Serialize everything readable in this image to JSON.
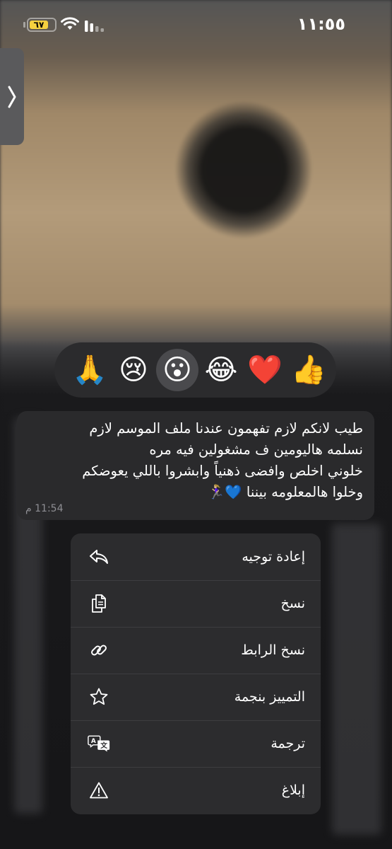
{
  "status_bar": {
    "time": "١١:٥٥",
    "battery_level": "٦٧"
  },
  "reactions": [
    {
      "emoji": "👍",
      "name": "thumbs-up"
    },
    {
      "emoji": "❤️",
      "name": "heart"
    },
    {
      "emoji": "😂",
      "name": "laughing"
    },
    {
      "emoji": "😮",
      "name": "surprised",
      "selected": true
    },
    {
      "emoji": "😢",
      "name": "crying"
    },
    {
      "emoji": "🙏",
      "name": "praying"
    }
  ],
  "message": {
    "line1": "طيب لانكم لازم تفهمون عندنا ملف الموسم لازم",
    "line2": "نسلمه هاليومين ف مشغولين فيه مره",
    "line3": "خلوني اخلص وافضى ذهنياً وابشروا باللي يعوضكم",
    "line4": "وخلوا هالمعلومه بيننا 💙🏃🏼‍♀️",
    "time": "11:54 م"
  },
  "menu": {
    "forward": "إعادة توجيه",
    "copy": "نسخ",
    "copy_link": "نسخ الرابط",
    "star": "التمييز بنجمة",
    "translate": "ترجمة",
    "report": "إبلاغ"
  }
}
